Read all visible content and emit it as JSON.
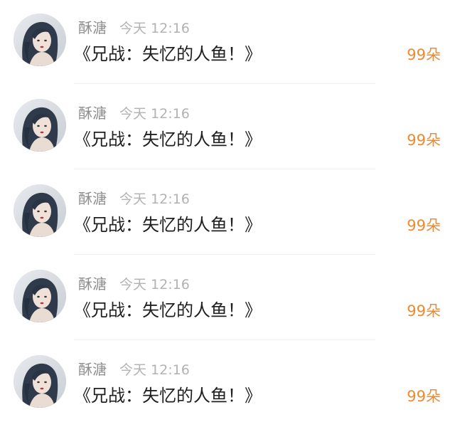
{
  "colors": {
    "username": "#8e8e8e",
    "timestamp": "#b2b2b2",
    "title": "#1f1f1f",
    "count": "#f08a2c",
    "divider": "#efefef"
  },
  "avatar_icon": "user-avatar-icon",
  "items": [
    {
      "username": "酥溏",
      "time": "今天 12:16",
      "title": "《兄战：失忆的人鱼！》",
      "count": "99朵"
    },
    {
      "username": "酥溏",
      "time": "今天 12:16",
      "title": "《兄战：失忆的人鱼！》",
      "count": "99朵"
    },
    {
      "username": "酥溏",
      "time": "今天 12:16",
      "title": "《兄战：失忆的人鱼！》",
      "count": "99朵"
    },
    {
      "username": "酥溏",
      "time": "今天 12:16",
      "title": "《兄战：失忆的人鱼！》",
      "count": "99朵"
    },
    {
      "username": "酥溏",
      "time": "今天 12:16",
      "title": "《兄战：失忆的人鱼！》",
      "count": "99朵"
    }
  ]
}
